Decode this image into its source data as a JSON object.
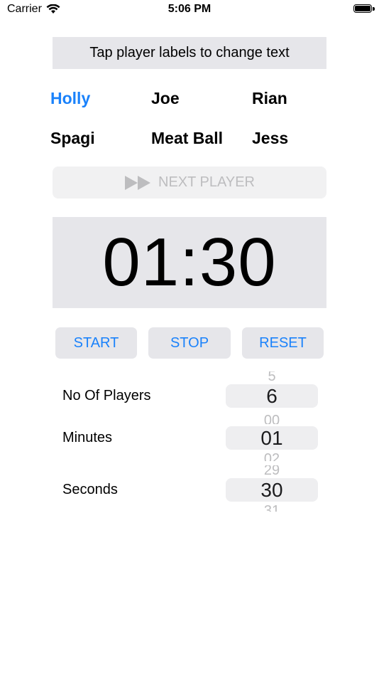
{
  "status_bar": {
    "carrier": "Carrier",
    "time": "5:06 PM"
  },
  "banner": {
    "text": "Tap player labels to change text"
  },
  "players": [
    {
      "label": "Holly",
      "active": true
    },
    {
      "label": "Joe",
      "active": false
    },
    {
      "label": "Rian",
      "active": false
    },
    {
      "label": "Spagi",
      "active": false
    },
    {
      "label": "Meat Ball",
      "active": false
    },
    {
      "label": "Jess",
      "active": false
    }
  ],
  "next_player": {
    "label": "NEXT PLAYER",
    "icon": "fast-forward-icon"
  },
  "timer": {
    "value": "01:30"
  },
  "controls": {
    "start": "START",
    "stop": "STOP",
    "reset": "RESET"
  },
  "settings": {
    "players": {
      "label": "No Of Players",
      "value": "6",
      "prev": "5"
    },
    "minutes": {
      "label": "Minutes",
      "value": "01",
      "prev": "00",
      "next": "02"
    },
    "seconds": {
      "label": "Seconds",
      "value": "30",
      "prev": "29",
      "next": "31"
    }
  },
  "colors": {
    "accent": "#1a82fb",
    "panel": "#e6e6ea",
    "disabled": "#bdbdbf"
  }
}
